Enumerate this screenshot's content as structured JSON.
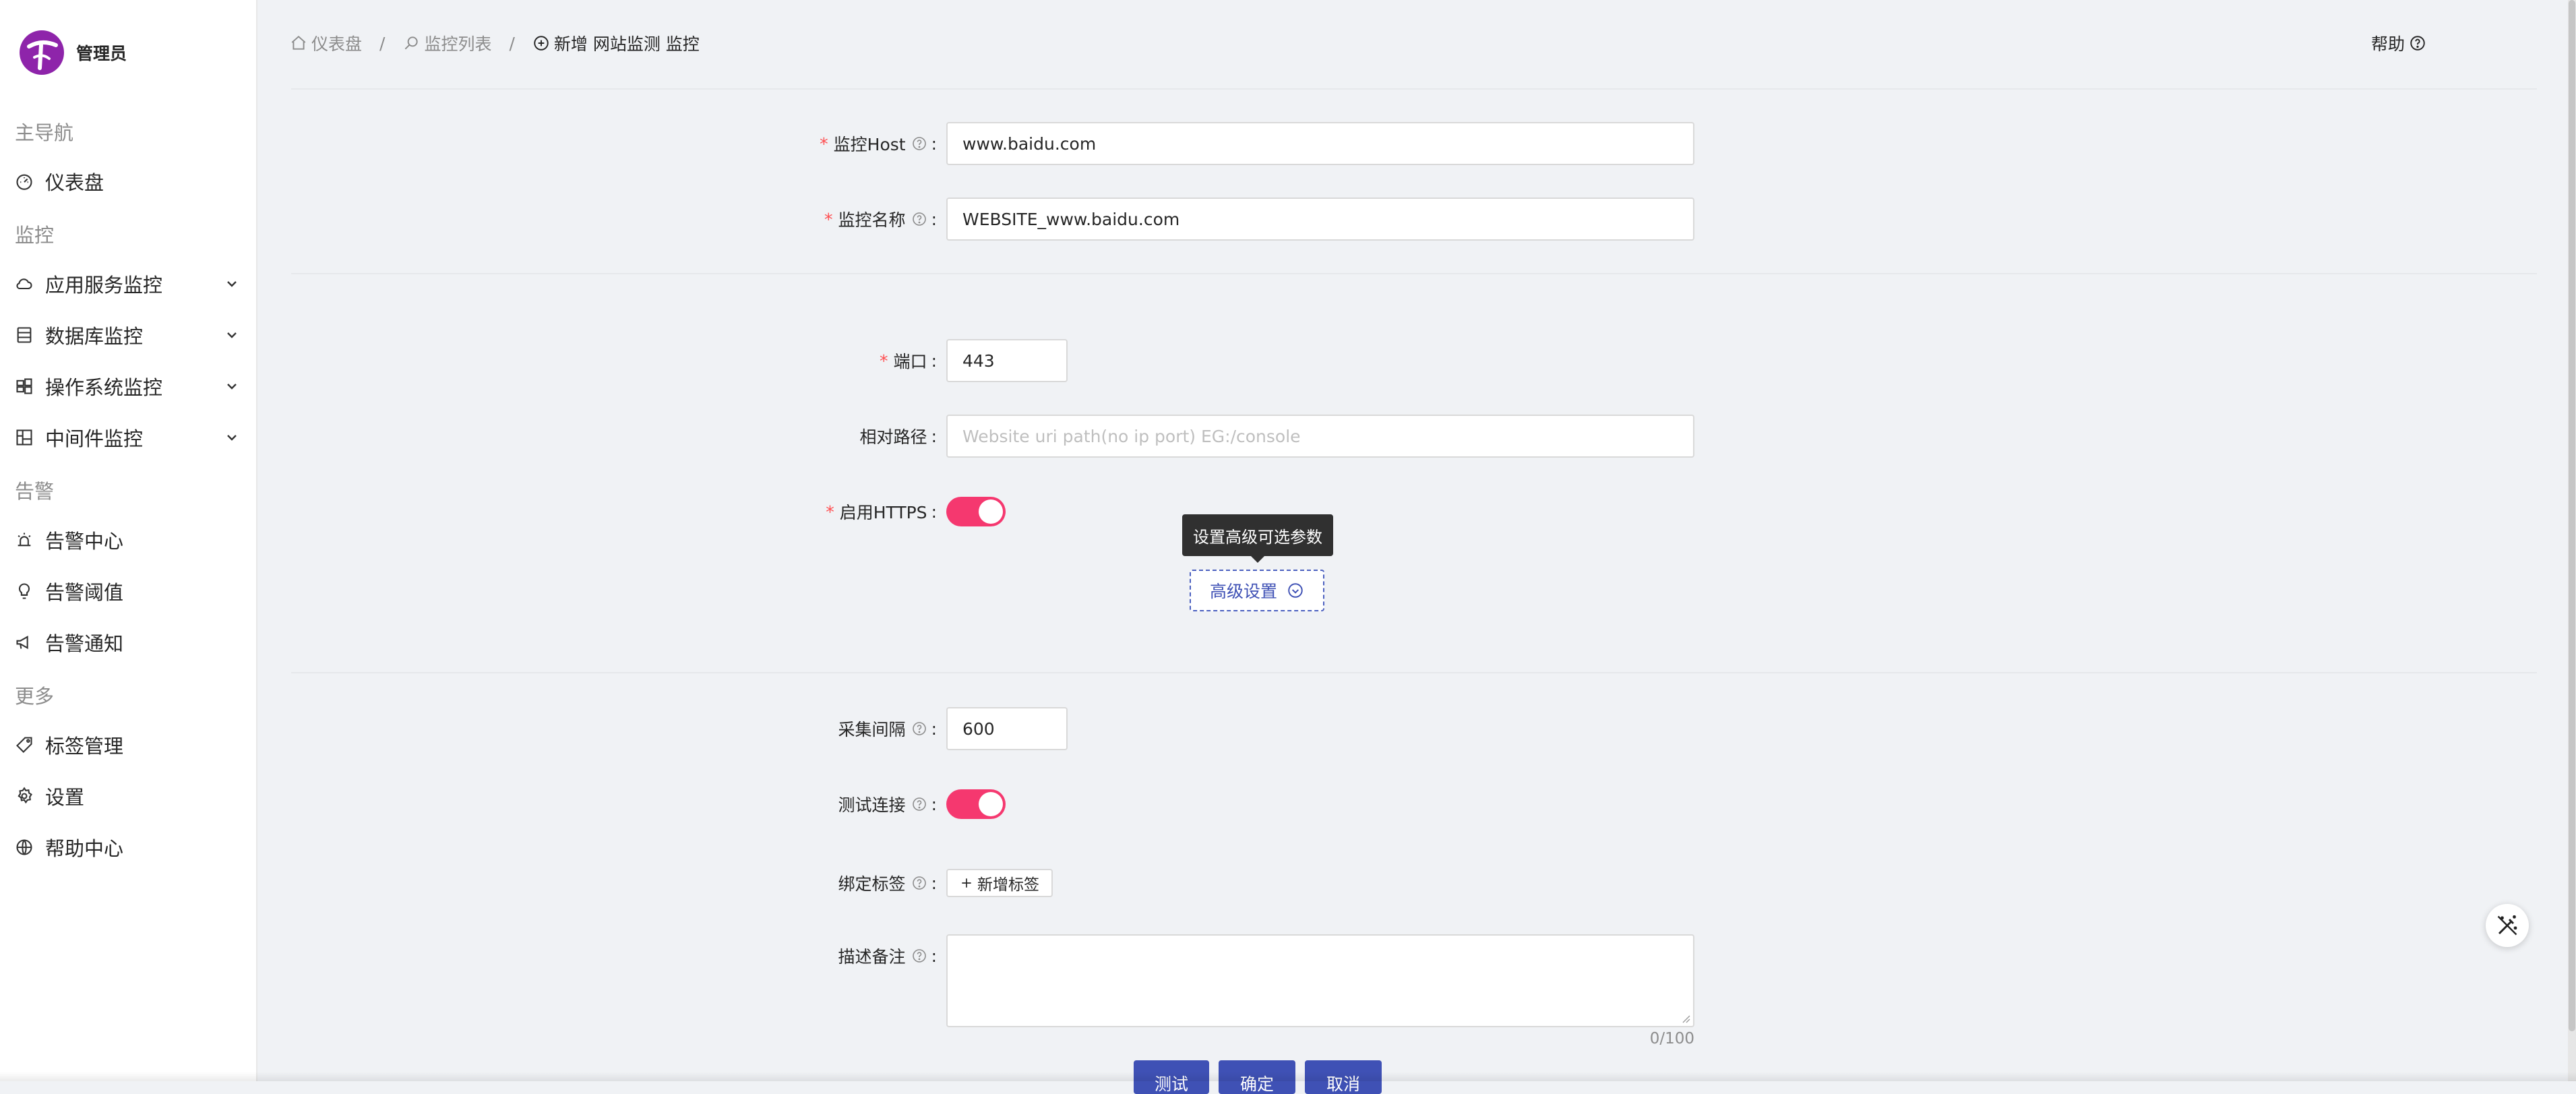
{
  "brand": {
    "name": "管理员",
    "color": "#8e24aa"
  },
  "nav": {
    "group_main": "主导航",
    "dashboard": "仪表盘",
    "group_monitor": "监控",
    "app_service": "应用服务监控",
    "database": "数据库监控",
    "os": "操作系统监控",
    "middleware": "中间件监控",
    "group_alert": "告警",
    "alert_center": "告警中心",
    "alert_threshold": "告警阈值",
    "alert_notice": "告警通知",
    "group_more": "更多",
    "tags": "标签管理",
    "settings": "设置",
    "help_center": "帮助中心"
  },
  "breadcrumb": {
    "home": "仪表盘",
    "list": "监控列表",
    "current": "新增 网站监测 监控"
  },
  "header": {
    "help": "帮助"
  },
  "form": {
    "host_label": "监控Host",
    "host_value": "www.baidu.com",
    "name_label": "监控名称",
    "name_value": "WEBSITE_www.baidu.com",
    "port_label": "端口",
    "port_value": "443",
    "path_label": "相对路径",
    "path_placeholder": "Website uri path(no ip port) EG:/console",
    "https_label": "启用HTTPS",
    "https_enabled": true,
    "advanced_tooltip": "设置高级可选参数",
    "advanced_button": "高级设置",
    "interval_label": "采集间隔",
    "interval_value": "600",
    "test_conn_label": "测试连接",
    "test_conn_enabled": true,
    "tags_label": "绑定标签",
    "add_tag_button": "新增标签",
    "desc_label": "描述备注",
    "desc_counter": "0/100",
    "colon": ":"
  },
  "actions": {
    "test": "测试",
    "confirm": "确定",
    "cancel": "取消"
  },
  "colors": {
    "accent": "#3f51b5",
    "switch_on": "#f5386f",
    "required": "#ff4d4f"
  }
}
